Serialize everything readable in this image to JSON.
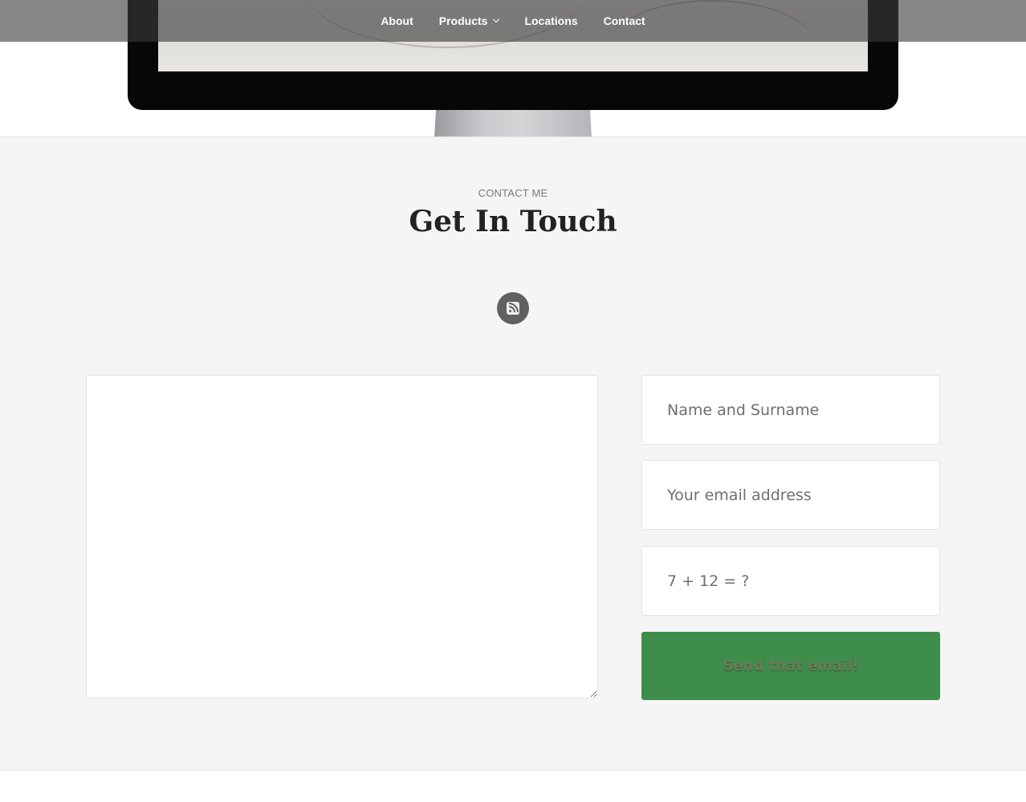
{
  "nav": {
    "items": [
      {
        "label": "About"
      },
      {
        "label": "Products"
      },
      {
        "label": "Locations"
      },
      {
        "label": "Contact"
      }
    ]
  },
  "contact": {
    "eyebrow": "CONTACT ME",
    "heading": "Get In Touch",
    "social_icon": "rss-icon",
    "message_value": "",
    "name_placeholder": "Name and Surname",
    "email_placeholder": "Your email address",
    "captcha_placeholder": "7 + 12 = ?",
    "send_label": "Send that email!"
  },
  "colors": {
    "button_green": "#3e8d4b",
    "section_bg": "#f5f5f5",
    "heading": "#222222"
  }
}
